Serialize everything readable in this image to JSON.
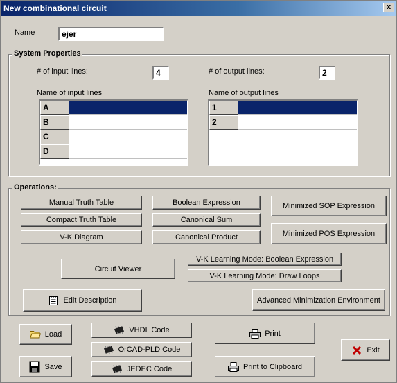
{
  "window": {
    "title": "New combinational circuit",
    "close_glyph": "x"
  },
  "name_field": {
    "label": "Name",
    "value": "ejer"
  },
  "system": {
    "title": "System Properties",
    "input_lines_label": "# of input lines:",
    "input_lines_value": "4",
    "output_lines_label": "# of output lines:",
    "output_lines_value": "2",
    "input_names_label": "Name of input lines",
    "output_names_label": "Name of output lines",
    "input_rows": [
      "A",
      "B",
      "C",
      "D"
    ],
    "output_rows": [
      "1",
      "2"
    ]
  },
  "operations": {
    "title": "Operations:",
    "manual_truth_table": "Manual Truth Table",
    "compact_truth_table": "Compact Truth Table",
    "vk_diagram": "V-K Diagram",
    "boolean_expression": "Boolean Expression",
    "canonical_sum": "Canonical Sum",
    "canonical_product": "Canonical Product",
    "minimized_sop": "Minimized SOP Expression",
    "minimized_pos": "Minimized POS Expression",
    "circuit_viewer": "Circuit Viewer",
    "vk_learning_boolean": "V-K Learning Mode: Boolean Expression",
    "vk_learning_loops": "V-K Learning Mode: Draw Loops",
    "edit_description": "Edit Description",
    "advanced_minimization": "Advanced Minimization Environment"
  },
  "footer": {
    "load": "Load",
    "save": "Save",
    "vhdl": "VHDL Code",
    "orcad": "OrCAD-PLD Code",
    "jedec": "JEDEC Code",
    "print": "Print",
    "print_clipboard": "Print to Clipboard",
    "exit": "Exit"
  },
  "colors": {
    "title_bar": "#0a246a",
    "selection": "#0a246a",
    "exit_x": "#c00000"
  }
}
